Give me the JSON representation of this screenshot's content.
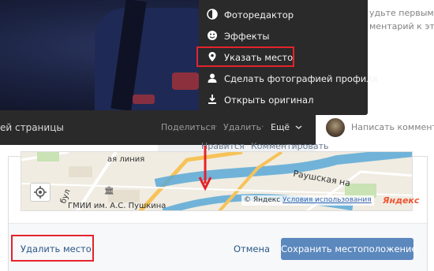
{
  "side_panel": {
    "line1": "удьте первым, кто",
    "line2": "ментарий к этой с"
  },
  "bar": {
    "page_label": "ей страницы",
    "share": "Поделиться",
    "delete": "Удалить",
    "more": "Ещё"
  },
  "comment": {
    "placeholder": "Написать комментар"
  },
  "menu": {
    "items": [
      {
        "label": "Фоторедактор",
        "icon": "photo-editor-icon"
      },
      {
        "label": "Эффекты",
        "icon": "effects-icon"
      },
      {
        "label": "Указать место",
        "icon": "location-pin-icon"
      },
      {
        "label": "Сделать фотографией профиля",
        "icon": "profile-icon"
      },
      {
        "label": "Открыть оригинал",
        "icon": "download-icon"
      }
    ]
  },
  "below": {
    "like": "Нравится",
    "comment": "Комментировать"
  },
  "map": {
    "labels": {
      "street": "Раушская на",
      "museum": "ГМИИ им. А.С. Пушкина",
      "avenue": "бул",
      "top_street": "ая линия"
    },
    "copyright": "© Яндекс",
    "terms": "Условия использования",
    "brand": "Яндекс"
  },
  "footer": {
    "delete_place": "Удалить место",
    "cancel": "Отмена",
    "save": "Сохранить местоположение"
  },
  "colors": {
    "accent_red": "#e3232c",
    "button_blue": "#5b88bd",
    "link_blue": "#2a5885"
  }
}
